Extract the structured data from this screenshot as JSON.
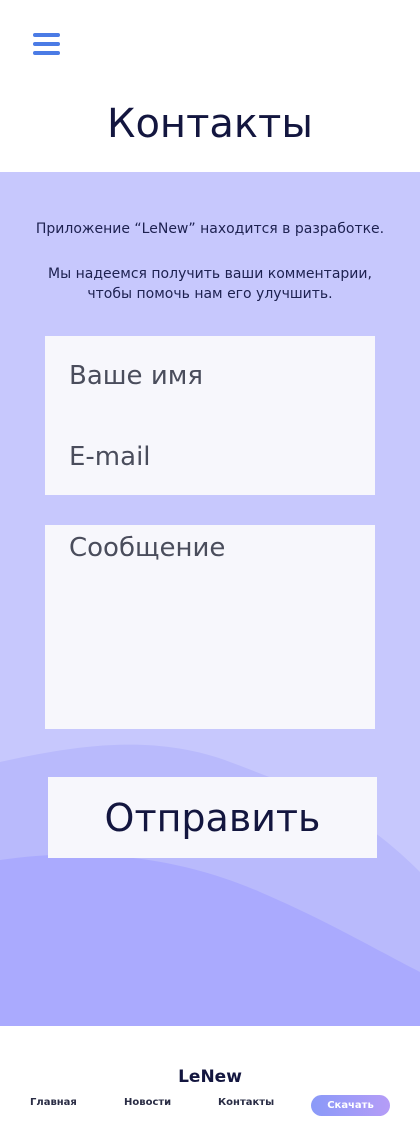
{
  "header": {
    "menu_icon": "hamburger-menu-icon",
    "title": "Контакты"
  },
  "intro": {
    "line1": "Приложение “LeNew” находится в разработке.",
    "line2": "Мы надеемся получить ваши комментарии, чтобы помочь нам его улучшить."
  },
  "form": {
    "name_placeholder": "Ваше имя",
    "email_placeholder": "E-mail",
    "message_placeholder": "Сообщение",
    "submit_label": "Отправить"
  },
  "footer": {
    "logo": "LeNew",
    "nav": {
      "home": "Главная",
      "news": "Новости",
      "contacts": "Контакты"
    },
    "download_label": "Скачать"
  },
  "colors": {
    "accent": "#4b7be5",
    "background_light": "#c7c8fd",
    "wave_mid": "#b9bafc",
    "wave_dark": "#aaaafe",
    "field_background": "#f7f7fc",
    "title_text": "#13163f",
    "button_gradient_start": "#8a9af8",
    "button_gradient_end": "#b59cf7"
  }
}
